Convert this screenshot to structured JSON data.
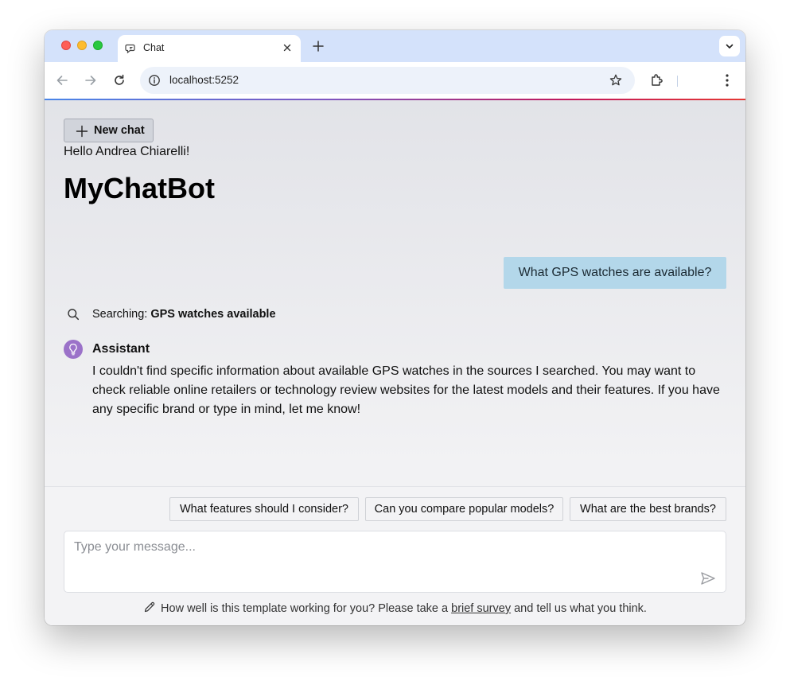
{
  "browser": {
    "tab_title": "Chat",
    "url": "localhost:5252"
  },
  "page": {
    "new_chat_label": "New chat",
    "greeting": "Hello Andrea Chiarelli!",
    "app_title": "MyChatBot",
    "user_message": "What GPS watches are available?",
    "search_prefix": "Searching:",
    "search_query": "GPS watches available",
    "assistant_name": "Assistant",
    "assistant_message": "I couldn't find specific information about available GPS watches in the sources I searched. You may want to check reliable online retailers or technology review websites for the latest models and their features. If you have any specific brand or type in mind, let me know!",
    "suggestions": [
      "What features should I consider?",
      "Can you compare popular models?",
      "What are the best brands?"
    ],
    "input_placeholder": "Type your message...",
    "survey": {
      "before": "How well is this template working for you? Please take a",
      "link": "brief survey",
      "after": "and tell us what you think."
    }
  },
  "colors": {
    "user_bubble": "#b3d7ea",
    "assistant_avatar": "#9b72c9",
    "tabstrip": "#d4e2fb"
  },
  "icons": [
    "chat-tab-icon",
    "close-icon",
    "plus-icon",
    "chevron-down-icon",
    "back-arrow-icon",
    "forward-arrow-icon",
    "reload-icon",
    "info-icon",
    "star-icon",
    "extensions-icon",
    "kebab-menu-icon",
    "search-icon",
    "lightbulb-icon",
    "send-icon",
    "pencil-icon"
  ]
}
